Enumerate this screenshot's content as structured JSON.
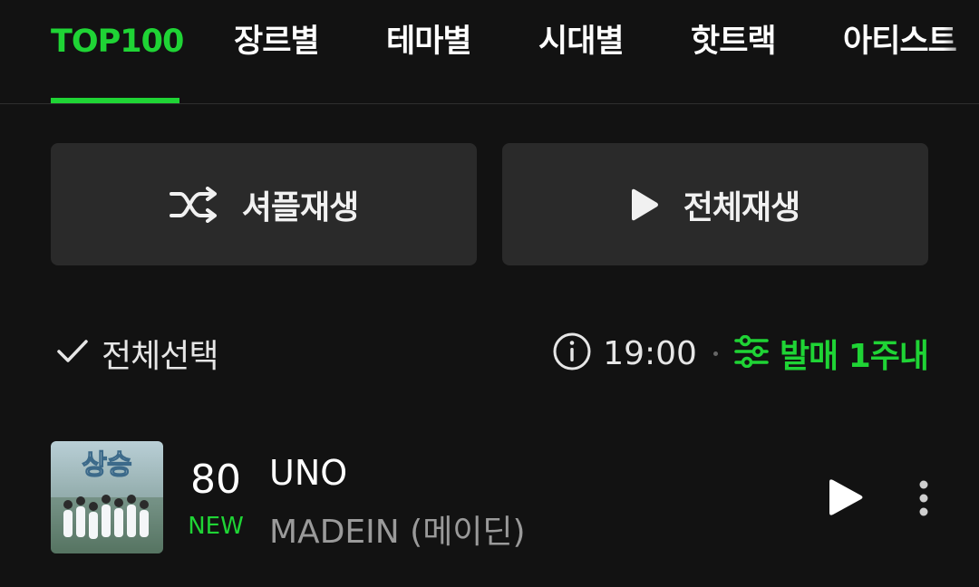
{
  "tabs": [
    {
      "label": "TOP100",
      "active": true
    },
    {
      "label": "장르별",
      "active": false
    },
    {
      "label": "테마별",
      "active": false
    },
    {
      "label": "시대별",
      "active": false
    },
    {
      "label": "핫트랙",
      "active": false
    },
    {
      "label": "아티스트",
      "active": false
    }
  ],
  "actions": {
    "shuffle_label": "셔플재생",
    "shuffle_icon": "shuffle-icon",
    "play_all_label": "전체재생",
    "play_all_icon": "play-icon"
  },
  "options": {
    "select_all_label": "전체선택",
    "update_time": "19:00",
    "filter_label": "발매 1주내"
  },
  "songs": [
    {
      "rank": "80",
      "rank_status": "NEW",
      "title": "UNO",
      "artist": "MADEIN (메이딘)",
      "album_art_text": "상승"
    }
  ],
  "colors": {
    "accent": "#1fd435",
    "background": "#121212",
    "button_bg": "#2a2a2a",
    "secondary_text": "#9a9a9a"
  }
}
